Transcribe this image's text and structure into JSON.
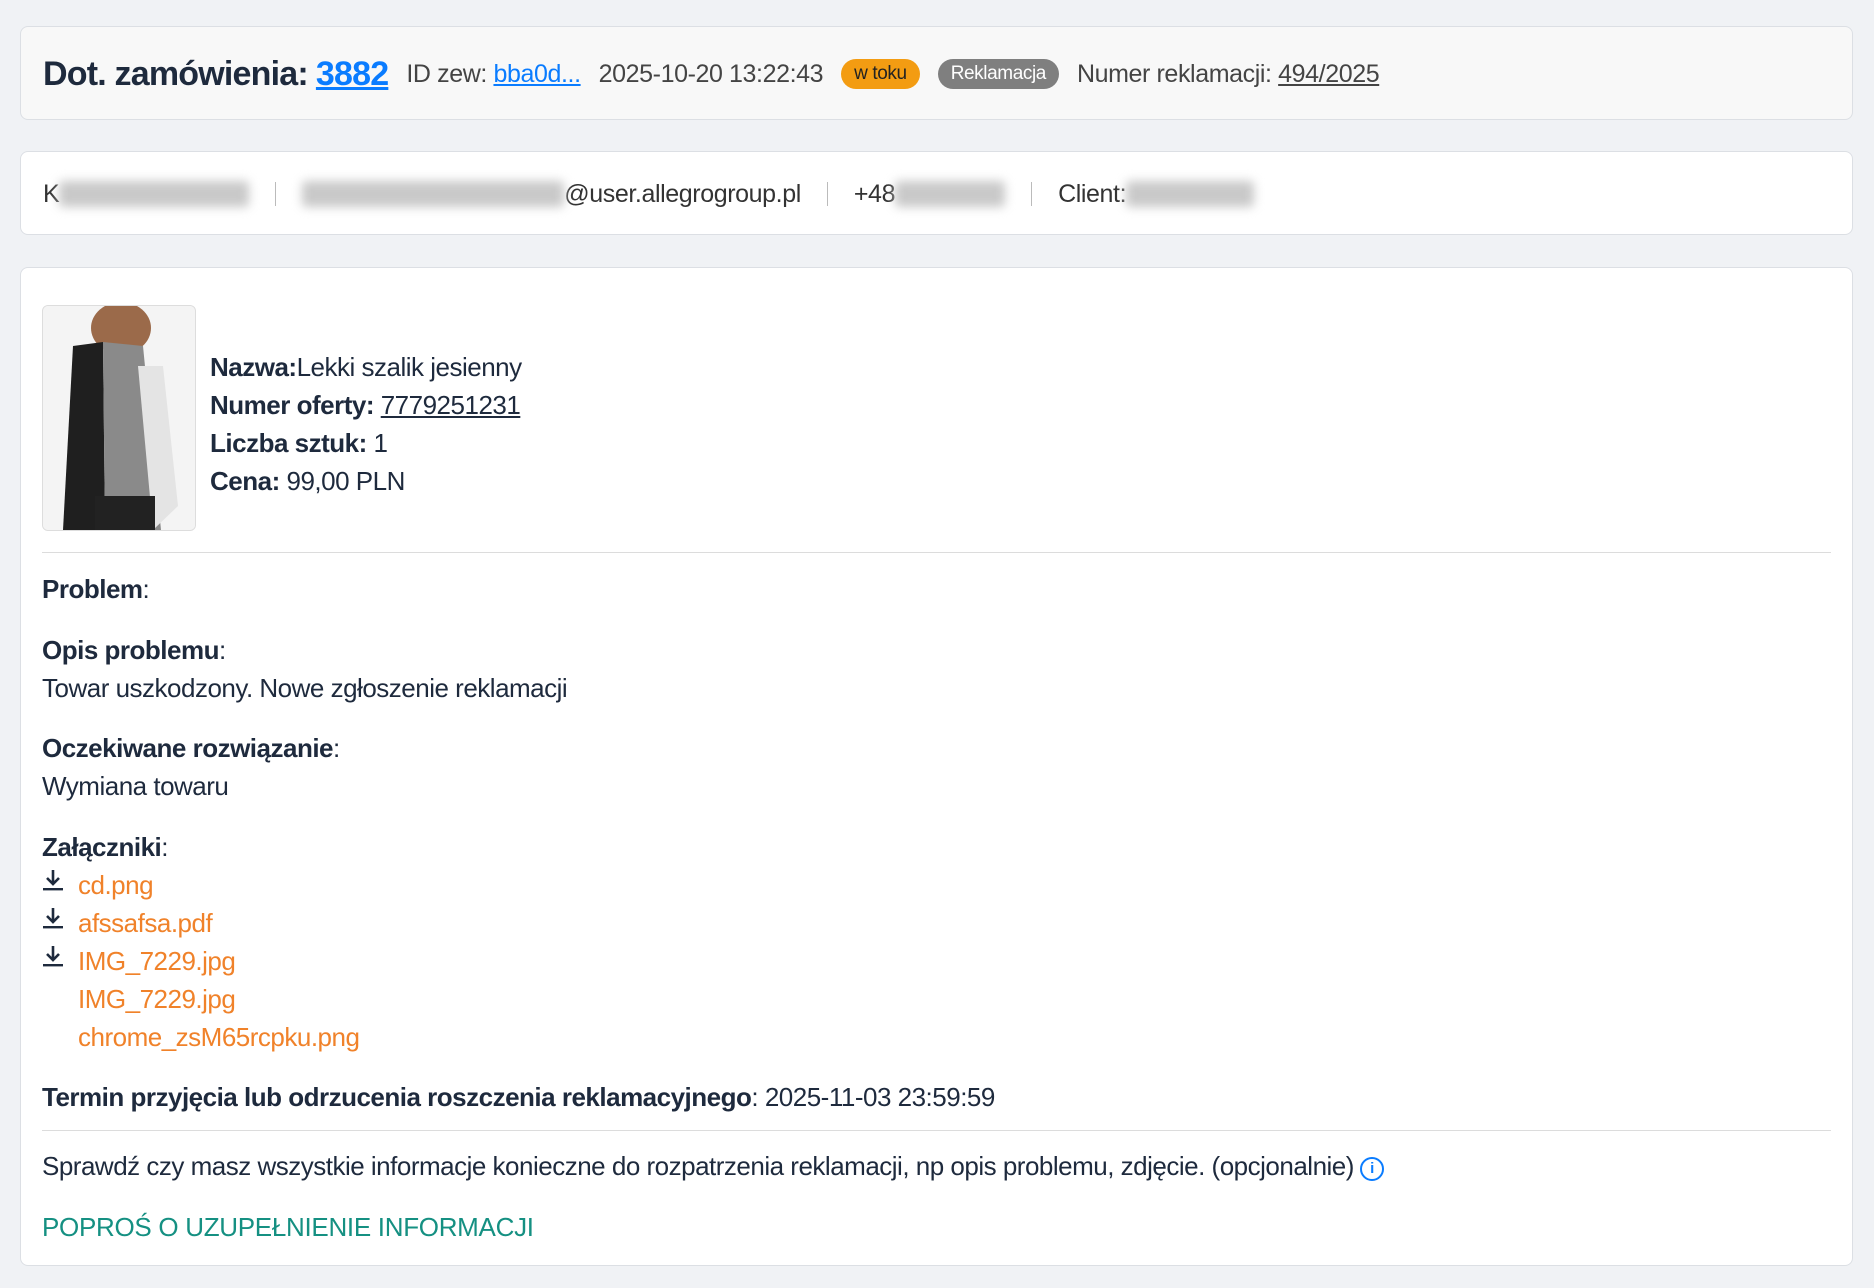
{
  "header": {
    "title_label": "Dot. zamówienia:",
    "order_number": "3882",
    "ext_id_label": "ID zew:",
    "ext_id_value": "bba0d...",
    "datetime": "2025-10-20 13:22:43",
    "status_badge": "w toku",
    "type_badge": "Reklamacja",
    "complaint_number_label": "Numer reklamacji:",
    "complaint_number": "494/2025"
  },
  "customer": {
    "name_initial": "K",
    "email_domain": "@user.allegrogroup.pl",
    "phone_prefix": "+48",
    "client_label": "Client:"
  },
  "product": {
    "name_label": "Nazwa:",
    "name": "Lekki szalik jesienny",
    "offer_label": "Numer oferty:",
    "offer_number": "7779251231",
    "quantity_label": "Liczba sztuk:",
    "quantity": "1",
    "price_label": "Cena:",
    "price": "99,00 PLN"
  },
  "complaint": {
    "problem_label": "Problem",
    "description_label": "Opis problemu",
    "description": "Towar uszkodzony. Nowe zgłoszenie reklamacji",
    "expected_label": "Oczekiwane rozwiązanie",
    "expected": "Wymiana towaru",
    "attachments_label": "Załączniki",
    "attachments": [
      {
        "name": "cd.png",
        "download": true
      },
      {
        "name": "afssafsa.pdf",
        "download": true
      },
      {
        "name": "IMG_7229.jpg",
        "download": true
      },
      {
        "name": "IMG_7229.jpg",
        "download": false
      },
      {
        "name": "chrome_zsM65rcpku.png",
        "download": false
      }
    ],
    "deadline_label": "Termin przyjęcia lub odrzucenia roszczenia reklamacyjnego",
    "deadline": "2025-11-03 23:59:59",
    "check_info": "Sprawdź czy masz wszystkie informacje konieczne do rozpatrzenia reklamacji, np opis problemu, zdjęcie. (opcjonalnie)",
    "request_button": "Poproś o uzupełnienie informacji"
  },
  "colors": {
    "link": "#0a7cff",
    "status": "#f39c12",
    "badge": "#7f7f7f",
    "attachment": "#f0822a",
    "action": "#159082"
  }
}
